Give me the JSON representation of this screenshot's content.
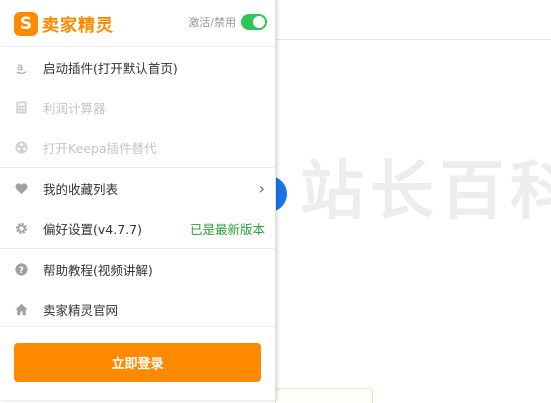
{
  "header": {
    "logo_icon": "S",
    "logo_text": "卖家精灵",
    "toggle_label": "激活/禁用",
    "toggle_on": true
  },
  "menu": [
    {
      "icon": "amazon-icon",
      "label": "启动插件(打开默认首页)",
      "disabled": false
    },
    {
      "icon": "calculator-icon",
      "label": "利润计算器",
      "disabled": true
    },
    {
      "icon": "keepa-icon",
      "label": "打开Keepa插件替代",
      "disabled": true
    },
    {
      "icon": "heart-icon",
      "label": "我的收藏列表",
      "disabled": false,
      "right": "›"
    },
    {
      "icon": "gear-icon",
      "label": "偏好设置(v4.7.7)",
      "disabled": false,
      "right": "已是最新版本"
    },
    {
      "icon": "help-icon",
      "label": "帮助教程(视频讲解)",
      "disabled": false
    },
    {
      "icon": "home-icon",
      "label": "卖家精灵官网",
      "disabled": false
    }
  ],
  "login_button": "立即登录",
  "watermark": "站长百科",
  "colors": {
    "brand": "#ff8a00",
    "toggle": "#2fc45a",
    "latest": "#2e9e3a",
    "blue": "#1a73e8"
  }
}
